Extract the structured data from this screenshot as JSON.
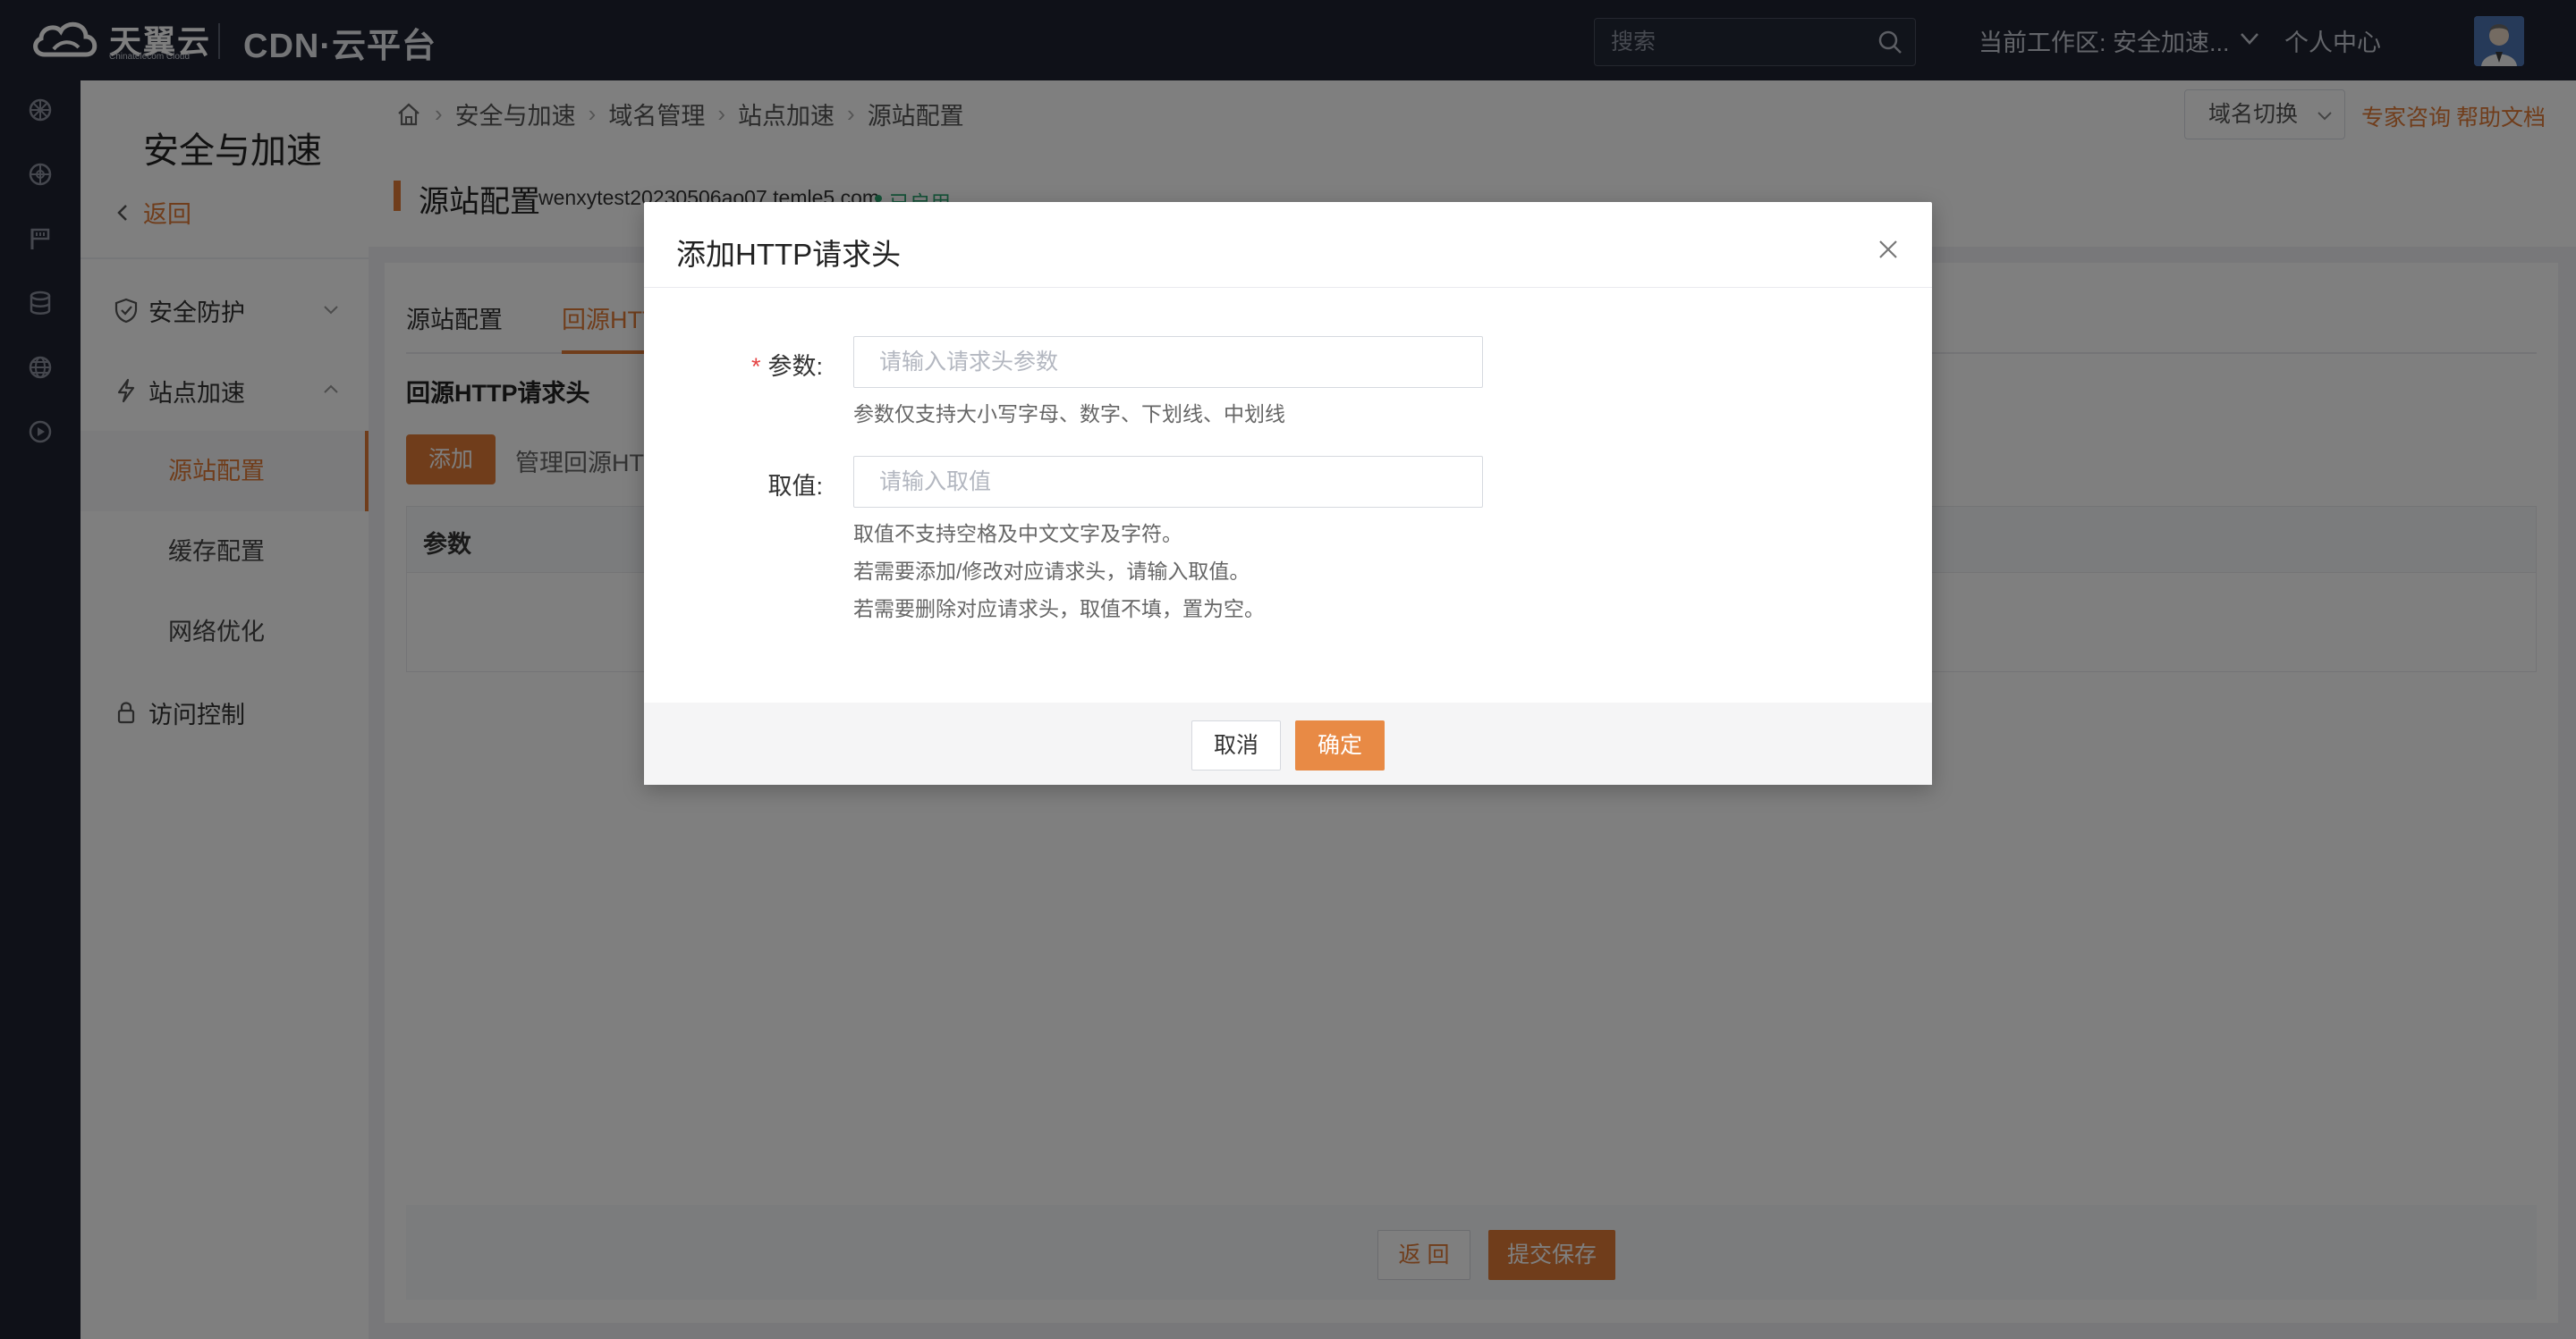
{
  "topbar": {
    "brand_cn": "天翼云",
    "brand_en": "Chinatelecom Cloud",
    "product": "CDN·云平台",
    "search_placeholder": "搜索",
    "workspace": "当前工作区: 安全加速...",
    "personal_center": "个人中心",
    "bg_color": "#1f2330"
  },
  "rail": {
    "icons": [
      "network-icon",
      "compass-icon",
      "flag-icon",
      "database-icon",
      "globe-icon",
      "play-icon"
    ]
  },
  "sidebar": {
    "title": "安全与加速",
    "back": "返回",
    "menus": [
      {
        "label": "安全防护",
        "icon": "shield-icon",
        "expanded": false
      },
      {
        "label": "站点加速",
        "icon": "lightning-icon",
        "expanded": true
      },
      {
        "label": "访问控制",
        "icon": "lock-icon"
      }
    ],
    "submenu": [
      "源站配置",
      "缓存配置",
      "网络优化"
    ],
    "active_submenu": "源站配置"
  },
  "breadcrumb": [
    "安全与加速",
    "域名管理",
    "站点加速",
    "源站配置"
  ],
  "header_actions": {
    "domain_switch": "域名切换",
    "expert": "专家咨询",
    "help": "帮助文档"
  },
  "page": {
    "title": "源站配置",
    "domain": "wenxytest20230506ao07.temle5.com",
    "status": "已启用"
  },
  "tabs": [
    "源站配置",
    "回源HTT"
  ],
  "section": {
    "title": "回源HTTP请求头",
    "add_button": "添加",
    "manage_text": "管理回源HTT",
    "table_header": "参数"
  },
  "footer": {
    "back": "返 回",
    "submit": "提交保存"
  },
  "modal": {
    "title": "添加HTTP请求头",
    "param_label": "参数:",
    "param_required": "*",
    "param_placeholder": "请输入请求头参数",
    "param_hint": "参数仅支持大小写字母、数字、下划线、中划线",
    "value_label": "取值:",
    "value_placeholder": "请输入取值",
    "value_hints": [
      "取值不支持空格及中文文字及字符。",
      "若需要添加/修改对应请求头，请输入取值。",
      "若需要删除对应请求头，取值不填，置为空。"
    ],
    "cancel": "取消",
    "ok": "确定"
  },
  "colors": {
    "accent": "#e07b37",
    "status_green": "#2ba471",
    "required_red": "#e54545"
  }
}
